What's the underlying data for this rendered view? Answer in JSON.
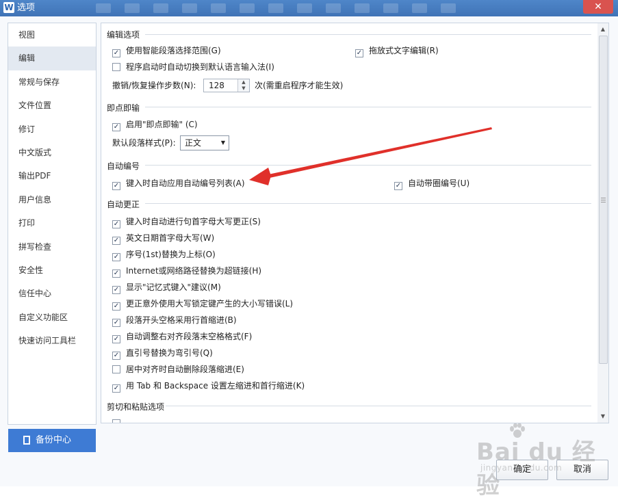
{
  "window": {
    "title": "选项",
    "app_icon": "W",
    "close_symbol": "✕"
  },
  "sidebar": {
    "items": [
      {
        "label": "视图"
      },
      {
        "label": "编辑",
        "selected": true
      },
      {
        "label": "常规与保存"
      },
      {
        "label": "文件位置"
      },
      {
        "label": "修订"
      },
      {
        "label": "中文版式"
      },
      {
        "label": "输出PDF"
      },
      {
        "label": "用户信息"
      },
      {
        "label": "打印"
      },
      {
        "label": "拼写检查"
      },
      {
        "label": "安全性"
      },
      {
        "label": "信任中心"
      },
      {
        "label": "自定义功能区"
      },
      {
        "label": "快速访问工具栏"
      }
    ],
    "backup_label": "备份中心"
  },
  "sections": {
    "edit_options": {
      "title": "编辑选项",
      "smart_paragraph": {
        "label": "使用智能段落选择范围(G)",
        "checked": true
      },
      "drag_drop": {
        "label": "拖放式文字编辑(R)",
        "checked": true
      },
      "auto_ime": {
        "label": "程序启动时自动切换到默认语言输入法(I)",
        "checked": false
      },
      "undo_steps_label": "撤销/恢复操作步数(N):",
      "undo_steps_value": "128",
      "undo_steps_note": "次(需重启程序才能生效)"
    },
    "click_type": {
      "title": "即点即输",
      "enable": {
        "label": "启用\"即点即输\" (C)",
        "checked": true
      },
      "default_style_label": "默认段落样式(P):",
      "default_style_value": "正文"
    },
    "auto_numbering": {
      "title": "自动编号",
      "apply_list": {
        "label": "键入时自动应用自动编号列表(A)",
        "checked": true
      },
      "circle_number": {
        "label": "自动带圈编号(U)",
        "checked": true
      }
    },
    "auto_correct": {
      "title": "自动更正",
      "items": [
        {
          "label": "键入时自动进行句首字母大写更正(S)",
          "checked": true
        },
        {
          "label": "英文日期首字母大写(W)",
          "checked": true
        },
        {
          "label": "序号(1st)替换为上标(O)",
          "checked": true
        },
        {
          "label": "Internet或网络路径替换为超链接(H)",
          "checked": true
        },
        {
          "label": "显示\"记忆式键入\"建议(M)",
          "checked": true
        },
        {
          "label": "更正意外使用大写锁定键产生的大小写错误(L)",
          "checked": true
        },
        {
          "label": "段落开头空格采用行首缩进(B)",
          "checked": true
        },
        {
          "label": "自动调整右对齐段落末空格格式(F)",
          "checked": true
        },
        {
          "label": "直引号替换为弯引号(Q)",
          "checked": true
        },
        {
          "label": "居中对齐时自动删除段落缩进(E)",
          "checked": false
        },
        {
          "label": "用 Tab 和 Backspace 设置左缩进和首行缩进(K)",
          "checked": true
        }
      ]
    },
    "cut_paste": {
      "title": "剪切和粘贴选项"
    }
  },
  "buttons": {
    "ok": "确定",
    "cancel": "取消"
  },
  "watermark": {
    "logo": "Bai du 经验",
    "sub": "jingyan.baidu.com"
  },
  "annotation_color": "#e0302a",
  "checked_mark": "✓"
}
